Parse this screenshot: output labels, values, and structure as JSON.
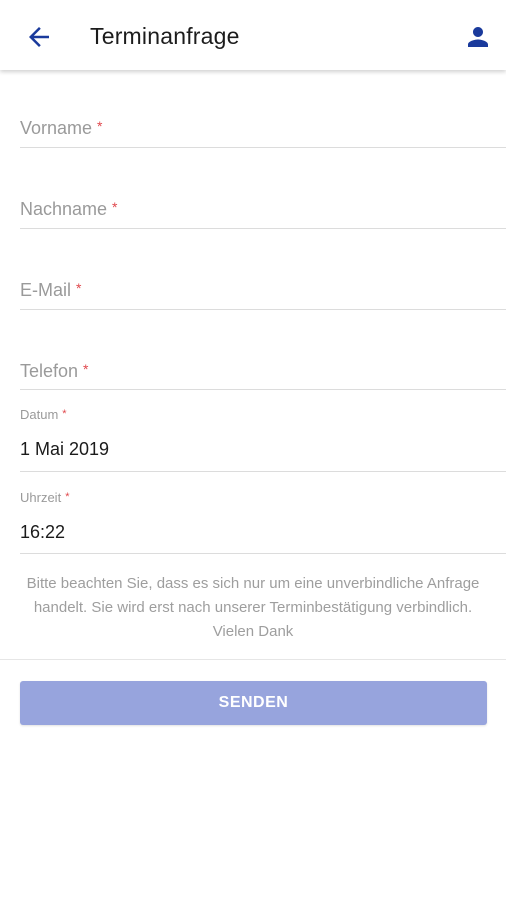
{
  "header": {
    "title": "Terminanfrage",
    "back_icon": "arrow-left-icon",
    "profile_icon": "person-icon",
    "accent_color": "#1a3a9c"
  },
  "form": {
    "required_marker": "*",
    "first_name": {
      "placeholder": "Vorname"
    },
    "last_name": {
      "placeholder": "Nachname"
    },
    "email": {
      "placeholder": "E-Mail"
    },
    "phone": {
      "placeholder": "Telefon"
    },
    "date": {
      "label": "Datum",
      "value": "1 Mai 2019"
    },
    "time": {
      "label": "Uhrzeit",
      "value": "16:22"
    }
  },
  "notice": "Bitte beachten Sie, dass es sich nur um eine unverbindliche Anfrage handelt. Sie wird erst nach unserer Terminbestätigung verbindlich. Vielen Dank",
  "submit": {
    "label": "SENDEN",
    "color": "#97a4dd"
  }
}
